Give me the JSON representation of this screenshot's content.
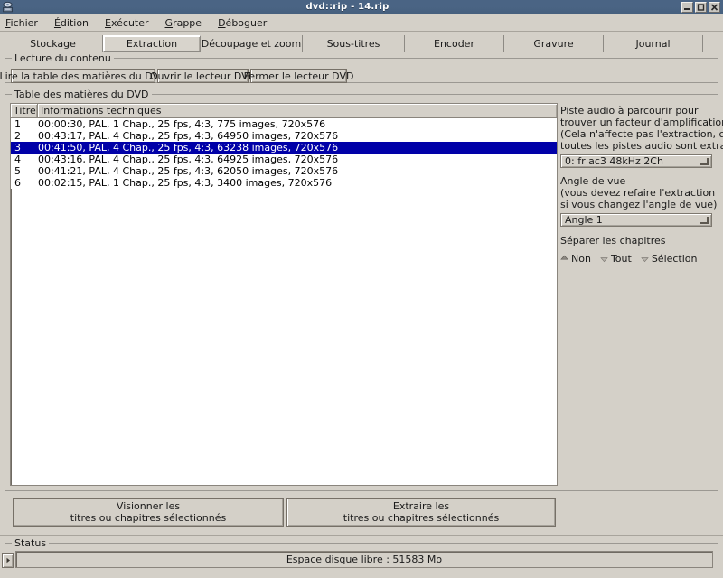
{
  "window": {
    "title": "dvd::rip - 14.rip",
    "icon": "app-icon",
    "controls": [
      {
        "name": "minimize",
        "glyph": "minimize-icon"
      },
      {
        "name": "maximize",
        "glyph": "maximize-icon"
      },
      {
        "name": "close",
        "glyph": "close-icon"
      }
    ]
  },
  "menubar": {
    "items": [
      {
        "accel": "F",
        "rest": "ichier"
      },
      {
        "accel": "É",
        "rest": "dition"
      },
      {
        "accel": "E",
        "rest": "xécuter"
      },
      {
        "accel": "G",
        "rest": "rappe"
      },
      {
        "accel": "D",
        "rest": "éboguer"
      }
    ]
  },
  "tabs": {
    "items": [
      {
        "label": "Stockage",
        "active": false
      },
      {
        "label": "Extraction",
        "active": true
      },
      {
        "label": "Découpage et zoom",
        "active": false
      },
      {
        "label": "Sous-titres",
        "active": false
      },
      {
        "label": "Encoder",
        "active": false
      },
      {
        "label": "Gravure",
        "active": false
      },
      {
        "label": "Journal",
        "active": false
      }
    ]
  },
  "content_group": {
    "title": "Lecture du contenu",
    "buttons": [
      {
        "label": "Lire la table des matières du DVD"
      },
      {
        "label": "Ouvrir le lecteur DVD"
      },
      {
        "label": "Fermer le lecteur DVD"
      }
    ]
  },
  "toc_group": {
    "title": "Table des matières du DVD",
    "columns": [
      "Titre",
      "Informations techniques"
    ],
    "rows": [
      {
        "num": "1",
        "info": "00:00:30, PAL, 1 Chap., 25 fps, 4:3, 775 images, 720x576",
        "selected": false
      },
      {
        "num": "2",
        "info": "00:43:17, PAL, 4 Chap., 25 fps, 4:3, 64950 images, 720x576",
        "selected": false
      },
      {
        "num": "3",
        "info": "00:41:50, PAL, 4 Chap., 25 fps, 4:3, 63238 images, 720x576",
        "selected": true
      },
      {
        "num": "4",
        "info": "00:43:16, PAL, 4 Chap., 25 fps, 4:3, 64925 images, 720x576",
        "selected": false
      },
      {
        "num": "5",
        "info": "00:41:21, PAL, 4 Chap., 25 fps, 4:3, 62050 images, 720x576",
        "selected": false
      },
      {
        "num": "6",
        "info": "00:02:15, PAL, 1 Chap., 25 fps, 4:3, 3400 images, 720x576",
        "selected": false
      }
    ]
  },
  "right_panel": {
    "audio": {
      "description_lines": [
        "Piste audio à parcourir pour",
        "trouver un facteur d'amplification.",
        "(Cela n'affecte pas l'extraction, car",
        "toutes les pistes audio sont extraites)"
      ],
      "selected": "0: fr ac3 48kHz 2Ch"
    },
    "angle": {
      "description_lines": [
        "Angle de vue",
        "(vous devez refaire l'extraction",
        "si vous changez l'angle de vue)"
      ],
      "selected": "Angle 1"
    },
    "chapters": {
      "label": "Séparer les chapitres",
      "options": [
        {
          "label": "Non",
          "selected": true
        },
        {
          "label": "Tout",
          "selected": false
        },
        {
          "label": "Sélection",
          "selected": false
        }
      ]
    }
  },
  "actions": {
    "view": {
      "line1": "Visionner les",
      "line2": "titres ou chapitres sélectionnés"
    },
    "extract": {
      "line1": "Extraire les",
      "line2": "titres ou chapitres sélectionnés"
    }
  },
  "status": {
    "title": "Status",
    "message": "Espace disque libre : 51583 Mo"
  },
  "colors": {
    "face": "#d4d0c8",
    "selection": "#0000a8",
    "titlebar": "#4a6484"
  }
}
